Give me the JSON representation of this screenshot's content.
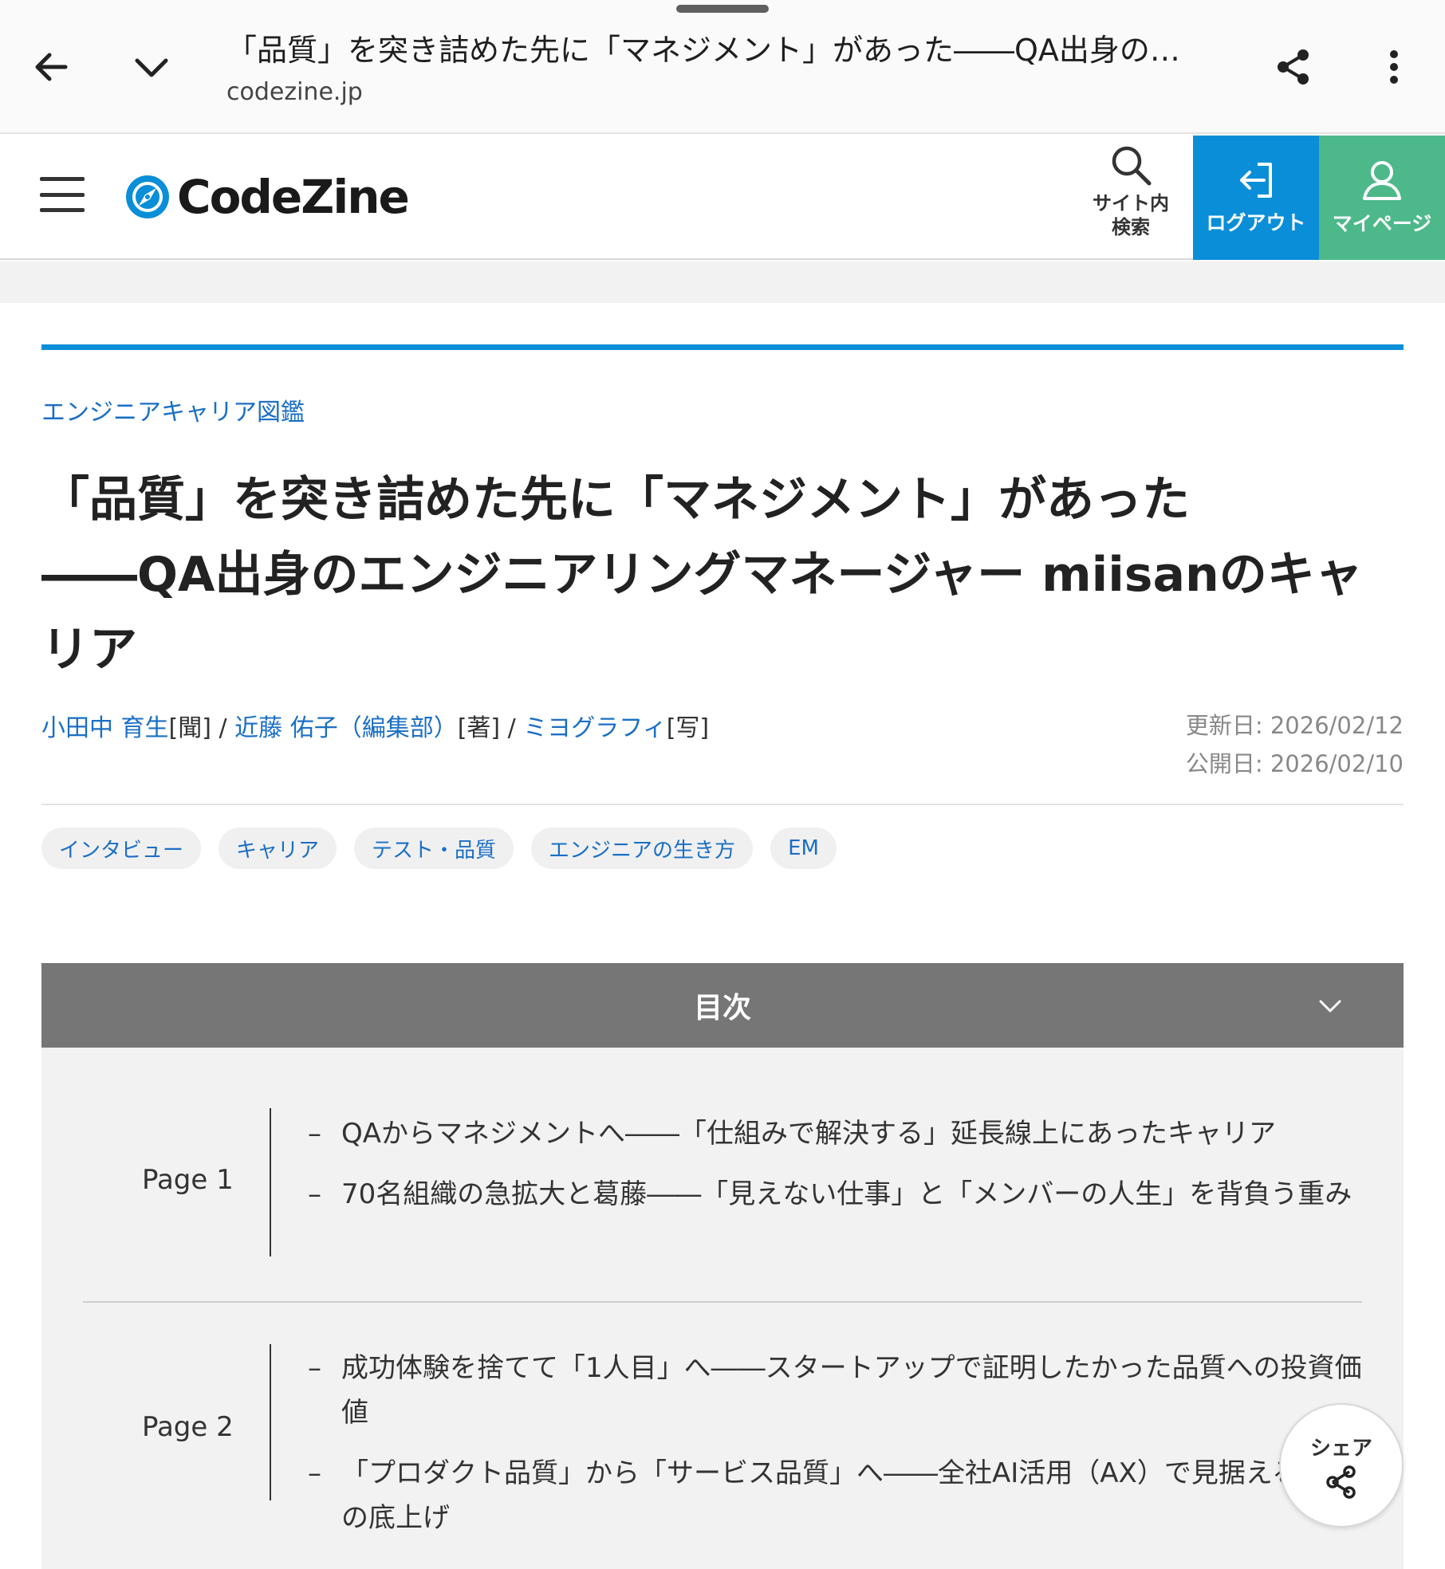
{
  "tabbar": {
    "title": "「品質」を突き詰めた先に「マネジメント」があった――QA出身のエンジニアリングマネージャー miisanのキャリア",
    "url": "codezine.jp",
    "icons": {
      "back": "arrow-left-icon",
      "minimize": "chevron-down-icon",
      "share": "share-icon",
      "menu": "more-vert-icon"
    }
  },
  "header": {
    "logo_text": "CodeZine",
    "search_label_line1": "サイト内",
    "search_label_line2": "検索",
    "logout_label": "ログアウト",
    "mypage_label": "マイページ",
    "colors": {
      "logout_bg": "#0a8ed8",
      "mypage_bg": "#4db88a",
      "accent": "#0a8ed8",
      "link": "#1a6fc4"
    }
  },
  "article": {
    "category": "エンジニアキャリア図鑑",
    "title_line1": "「品質」を突き詰めた先に「マネジメント」があった",
    "title_line2": "――QA出身のエンジニアリングマネージャー miisanのキャリア",
    "credits": [
      {
        "name": "小田中 育生",
        "role": "[聞]"
      },
      {
        "name": "近藤 佑子（編集部）",
        "role": "[著]"
      },
      {
        "name": "ミヨグラフィ",
        "role": "[写]"
      }
    ],
    "credit_separator": " / ",
    "updated": "更新日: 2026/02/12",
    "published": "公開日: 2026/02/10",
    "tags": [
      "インタビュー",
      "キャリア",
      "テスト・品質",
      "エンジニアの生き方",
      "EM"
    ]
  },
  "toc": {
    "title": "目次",
    "pages": [
      {
        "label": "Page 1",
        "entries": [
          "QAからマネジメントへ――「仕組みで解決する」延長線上にあったキャリア",
          "70名組織の急拡大と葛藤――「見えない仕事」と「メンバーの人生」を背負う重み"
        ]
      },
      {
        "label": "Page 2",
        "entries": [
          "成功体験を捨てて「1人目」へ――スタートアップで証明したかった品質への投資価値",
          "「プロダクト品質」から「サービス品質」へ――全社AI活用（AX）で見据える組織の底上げ"
        ]
      }
    ]
  },
  "float_share": {
    "label": "シェア"
  }
}
